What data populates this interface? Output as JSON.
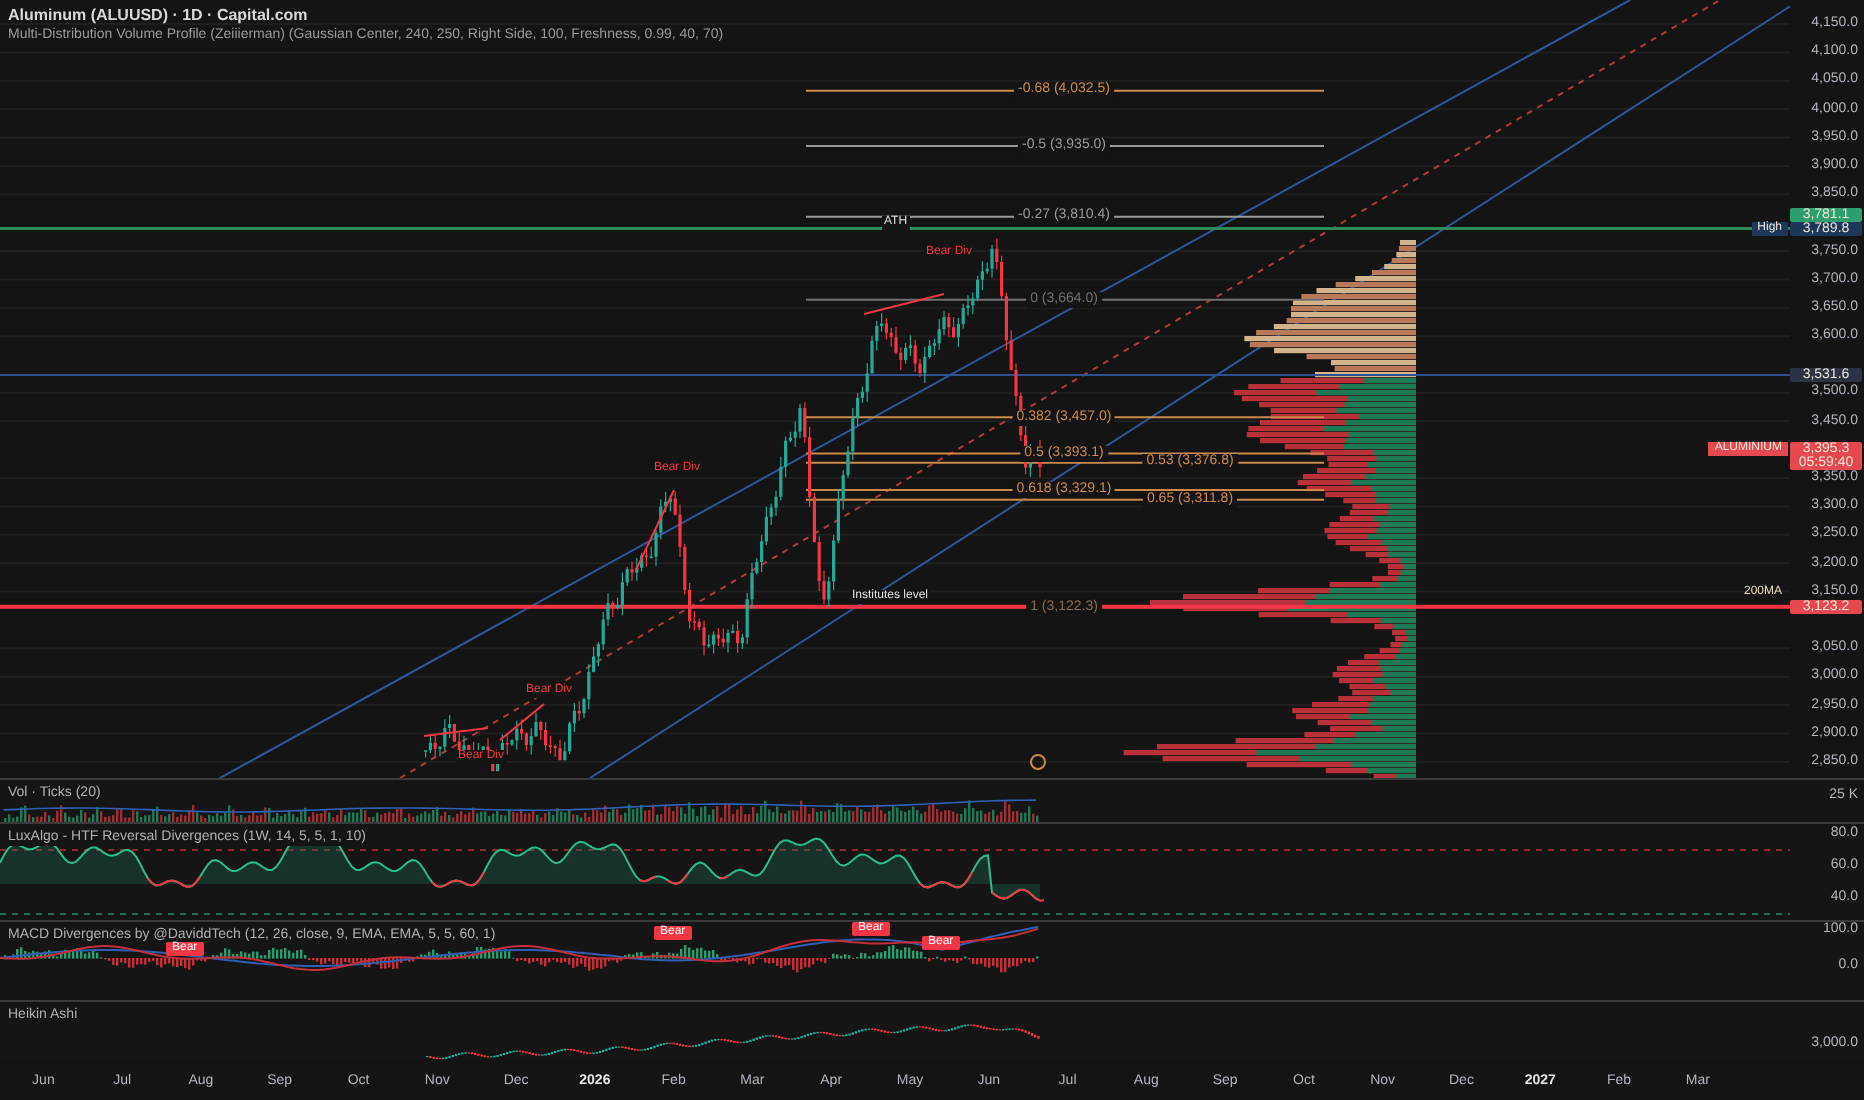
{
  "header": {
    "title": "Aluminum (ALUUSD) · 1D · Capital.com",
    "indicator": "Multi-Distribution Volume Profile (Zeiiierman) (Gaussian Center, 240, 250, Right Side, 100, Freshness, 0.99, 40, 70)"
  },
  "price_axis": {
    "ticks": [
      "4,150.0",
      "4,100.0",
      "4,050.0",
      "4,000.0",
      "3,950.0",
      "3,900.0",
      "3,850.0",
      "3,750.0",
      "3,700.0",
      "3,650.0",
      "3,600.0",
      "3,500.0",
      "3,450.0",
      "3,350.0",
      "3,300.0",
      "3,250.0",
      "3,200.0",
      "3,150.0",
      "3,050.0",
      "3,000.0",
      "2,950.0",
      "2,900.0",
      "2,850.0"
    ]
  },
  "price_tags": [
    {
      "value": "3,781.1",
      "color": "#2e9e6e"
    },
    {
      "label": "High",
      "kind": "badge",
      "value": "3,789.8",
      "color": "#1e3657"
    },
    {
      "value": "3,531.6",
      "color": "#2b3345"
    },
    {
      "label": "ALUMINIUM",
      "kind": "badge",
      "value": "3,395.3",
      "countdown": "05:59:40",
      "color": "#e5484d"
    },
    {
      "label": "200MA",
      "kind": "text",
      "value": "3,123.2",
      "color": "#e5484d"
    }
  ],
  "fib_levels": [
    {
      "label": "-0.68 (4,032.5)",
      "color": "#c98a4b"
    },
    {
      "label": "-0.5 (3,935.0)",
      "color": "#9a9a9a"
    },
    {
      "label": "-0.27 (3,810.4)",
      "color": "#9a9a9a"
    },
    {
      "label": "0 (3,664.0)",
      "color": "#6f6f6f"
    },
    {
      "label": "0.382 (3,457.0)",
      "color": "#c98a4b"
    },
    {
      "label": "0.5 (3,393.1)",
      "color": "#c98a4b"
    },
    {
      "label": "0.53 (3,376.8)",
      "color": "#c98a4b"
    },
    {
      "label": "0.618 (3,329.1)",
      "color": "#c98a4b"
    },
    {
      "label": "0.65 (3,311.8)",
      "color": "#c98a4b"
    },
    {
      "label": "1 (3,122.3)",
      "color": "#8a6a50"
    }
  ],
  "annotations": {
    "ath": "ATH",
    "institutes": "Institutes level",
    "bear_divs": [
      "Bear Div",
      "Bear Div",
      "Bear Div",
      "Bear Div"
    ]
  },
  "panes": [
    {
      "kind": "volume",
      "title": "Vol · Ticks (20)",
      "ticks": [
        "25 K"
      ]
    },
    {
      "kind": "oscillator",
      "title": "LuxAlgo - HTF Reversal Divergences (1W, 14, 5, 5, 1, 10)",
      "ticks": [
        "80.0",
        "60.0",
        "40.0"
      ]
    },
    {
      "kind": "macd",
      "title": "MACD Divergences by @DaviddTech (12, 26, close, 9, EMA, EMA, 5, 5, 60, 1)",
      "ticks": [
        "100.0",
        "0.0"
      ],
      "badges": [
        "Bear",
        "Bear",
        "Bear",
        "Bear"
      ]
    },
    {
      "kind": "heikin",
      "title": "Heikin Ashi",
      "ticks": [
        "3,000.0"
      ]
    }
  ],
  "time_axis": [
    {
      "text": "Jun",
      "kind": "month"
    },
    {
      "text": "Jul",
      "kind": "month"
    },
    {
      "text": "Aug",
      "kind": "month"
    },
    {
      "text": "Sep",
      "kind": "month"
    },
    {
      "text": "Oct",
      "kind": "month"
    },
    {
      "text": "Nov",
      "kind": "month"
    },
    {
      "text": "Dec",
      "kind": "month"
    },
    {
      "text": "2026",
      "kind": "year"
    },
    {
      "text": "Feb",
      "kind": "month"
    },
    {
      "text": "Mar",
      "kind": "month"
    },
    {
      "text": "Apr",
      "kind": "month"
    },
    {
      "text": "May",
      "kind": "month"
    },
    {
      "text": "Jun",
      "kind": "month"
    },
    {
      "text": "Jul",
      "kind": "month"
    },
    {
      "text": "Aug",
      "kind": "month"
    },
    {
      "text": "Sep",
      "kind": "month"
    },
    {
      "text": "Oct",
      "kind": "month"
    },
    {
      "text": "Nov",
      "kind": "month"
    },
    {
      "text": "Dec",
      "kind": "month"
    },
    {
      "text": "2027",
      "kind": "year"
    },
    {
      "text": "Feb",
      "kind": "month"
    },
    {
      "text": "Mar",
      "kind": "month"
    }
  ]
}
